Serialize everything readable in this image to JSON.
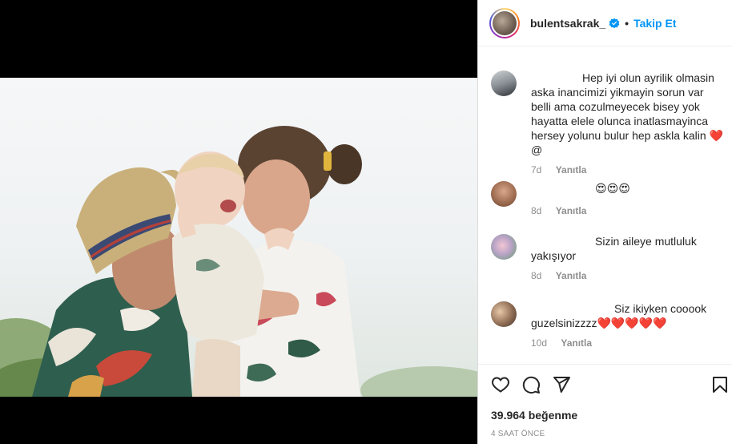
{
  "header": {
    "username": "bulentsakrak_",
    "separator": "•",
    "follow_label": "Takip Et"
  },
  "comments": [
    {
      "text": "Hep iyi olun ayrilik olmasin aska inancimizi yikmayin sorun var belli ama cozulmeyecek bisey yok hayatta elele olunca inatlasmayinca hersey yolunu bulur hep askla kalin ❤️ @",
      "age": "7d",
      "reply_label": "Yanıtla"
    },
    {
      "text": "😍😍😍",
      "age": "8d",
      "reply_label": "Yanıtla"
    },
    {
      "text": "Sizin aileye mutluluk yakışıyor",
      "age": "8d",
      "reply_label": "Yanıtla"
    },
    {
      "text": "Siz ikiyken cooook guzelsinizzzz❤️❤️❤️❤️❤️",
      "age": "10d",
      "reply_label": "Yanıtla"
    }
  ],
  "likes": "39.964 beğenme",
  "posted": "4 SAAT ÖNCE",
  "icons": {
    "like": "heart-icon",
    "comment": "comment-icon",
    "share": "paper-plane-icon",
    "save": "bookmark-icon",
    "verified": "verified-badge-icon"
  },
  "colors": {
    "accent": "#0095f6",
    "heart": "#ed4956",
    "verified": "#0095f6"
  }
}
